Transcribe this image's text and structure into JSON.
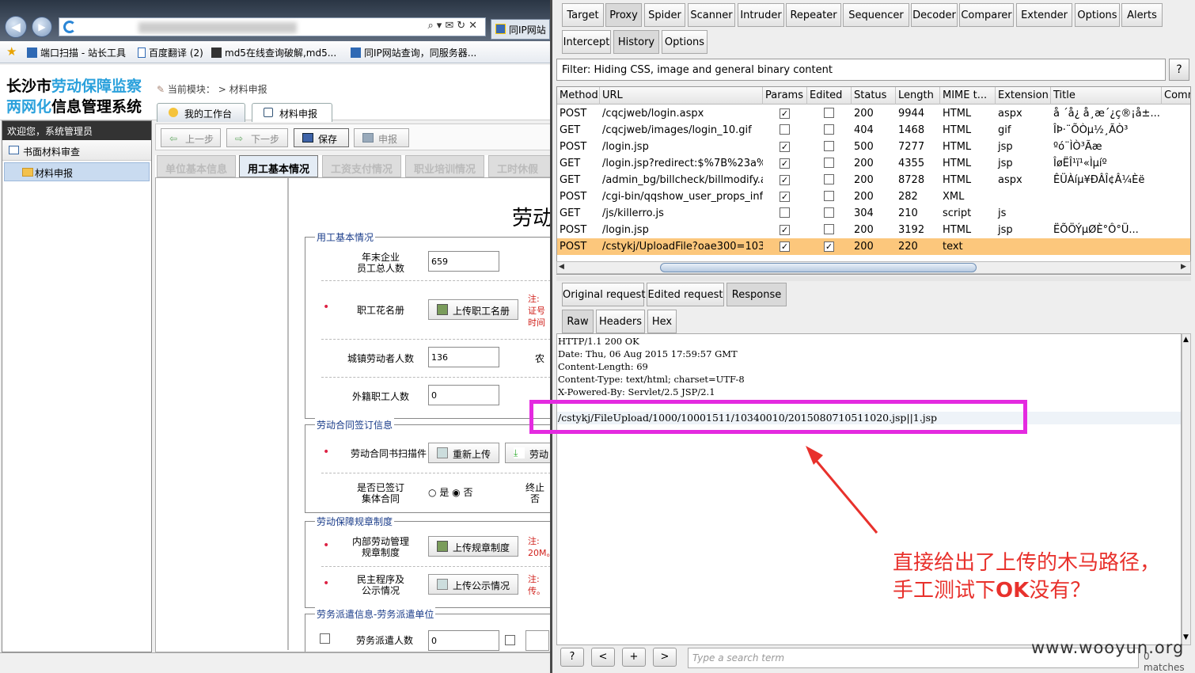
{
  "ie": {
    "tab_title": "同IP网站",
    "favorites": [
      {
        "label": "端口扫描 - 站长工具"
      },
      {
        "label": "百度翻译 (2)"
      },
      {
        "label": "md5在线查询破解,md5..."
      },
      {
        "label": "同IP网站查询，同服务器..."
      }
    ]
  },
  "app": {
    "logo_line1_a": "长沙市",
    "logo_line1_b": "劳动保障监察",
    "logo_line2_a": "两网化",
    "logo_line2_b": "信息管理系统",
    "breadcrumb_label": "当前模块：",
    "breadcrumb_value": "> 材料申报",
    "top_tabs": [
      "我的工作台",
      "材料申报"
    ],
    "sidebar": {
      "welcome": "欢迎您，系统管理员",
      "group": "书面材料审查",
      "item": "材料申报"
    },
    "toolbar": {
      "prev": "上一步",
      "next": "下一步",
      "save": "保存",
      "submit": "申报"
    },
    "form_tabs": [
      "单位基本信息",
      "用工基本情况",
      "工资支付情况",
      "职业培训情况",
      "工时休假"
    ],
    "doc_title": "劳动",
    "sections": [
      {
        "legend": "用工基本情况"
      },
      {
        "legend": "劳动合同签订信息"
      },
      {
        "legend": "劳动保障规章制度"
      },
      {
        "legend": "劳务派遣信息-劳务派遣单位"
      }
    ],
    "fields": {
      "total_staff_label_1": "年末企业",
      "total_staff_label_2": "员工总人数",
      "total_staff_value": "659",
      "roster_label": "职工花名册",
      "roster_btn": "上传职工名册",
      "roster_note_1": "注:",
      "roster_note_2": "证号",
      "roster_note_3": "时间",
      "urban_label": "城镇劳动者人数",
      "urban_value": "136",
      "urban_side": "农",
      "foreign_label": "外籍职工人数",
      "foreign_value": "0",
      "contract_scan_label": "劳动合同书扫描件",
      "contract_reupload": "重新上传",
      "contract_side_btn": "劳动",
      "collective_label_1": "是否已签订",
      "collective_label_2": "集体合同",
      "yes": "是",
      "no": "否",
      "collective_side_1": "终止",
      "collective_side_2": "否",
      "rules_label_1": "内部劳动管理",
      "rules_label_2": "规章制度",
      "rules_btn": "上传规章制度",
      "rules_note_1": "注:",
      "rules_note_2": "20M。",
      "democracy_label_1": "民主程序及",
      "democracy_label_2": "公示情况",
      "democracy_btn": "上传公示情况",
      "democracy_note_1": "注:",
      "democracy_note_2": "传。",
      "dispatch_label": "劳务派遣人数",
      "dispatch_value": "0"
    }
  },
  "burp": {
    "main_tabs": [
      "Target",
      "Proxy",
      "Spider",
      "Scanner",
      "Intruder",
      "Repeater",
      "Sequencer",
      "Decoder",
      "Comparer",
      "Extender",
      "Options",
      "Alerts"
    ],
    "sub_tabs": [
      "Intercept",
      "History",
      "Options"
    ],
    "filter": "Filter: Hiding CSS, image and general binary content",
    "filter_help": "?",
    "columns": [
      "Method",
      "URL",
      "Params",
      "Edited",
      "Status",
      "Length",
      "MIME t...",
      "Extension",
      "Title",
      "Comm"
    ],
    "rows": [
      {
        "method": "POST",
        "url": "/cqcjweb/login.aspx",
        "params": true,
        "edited": false,
        "status": "200",
        "length": "9944",
        "mime": "HTML",
        "ext": "aspx",
        "title": "å  ´å¿ å¸æ´¿ç®¡å±..."
      },
      {
        "method": "GET",
        "url": "/cqcjweb/images/login_10.gif",
        "params": false,
        "edited": false,
        "status": "404",
        "length": "1468",
        "mime": "HTML",
        "ext": "gif",
        "title": "ÎÞ·¨ÕÒµ½¸ÃÒ³"
      },
      {
        "method": "POST",
        "url": "/login.jsp",
        "params": true,
        "edited": false,
        "status": "500",
        "length": "7277",
        "mime": "HTML",
        "ext": "jsp",
        "title": "ºó¨ÌÒ³Ãæ"
      },
      {
        "method": "GET",
        "url": "/login.jsp?redirect:$%7B%23a%...",
        "params": true,
        "edited": false,
        "status": "200",
        "length": "4355",
        "mime": "HTML",
        "ext": "jsp",
        "title": "ÎøËÎ¹ï¹«Ìµíº"
      },
      {
        "method": "GET",
        "url": "/admin_bg/billcheck/billmodify.a...",
        "params": true,
        "edited": false,
        "status": "200",
        "length": "8728",
        "mime": "HTML",
        "ext": "aspx",
        "title": "ÊÜÀíµ¥ÐÂÎ¢Â¼Èë"
      },
      {
        "method": "POST",
        "url": "/cgi-bin/qqshow_user_props_info",
        "params": true,
        "edited": false,
        "status": "200",
        "length": "282",
        "mime": "XML",
        "ext": "",
        "title": ""
      },
      {
        "method": "GET",
        "url": "/js/killerro.js",
        "params": false,
        "edited": false,
        "status": "304",
        "length": "210",
        "mime": "script",
        "ext": "js",
        "title": ""
      },
      {
        "method": "POST",
        "url": "/login.jsp",
        "params": true,
        "edited": false,
        "status": "200",
        "length": "3192",
        "mime": "HTML",
        "ext": "jsp",
        "title": "ËÕÖÝµØÈ°Ô°Ü..."
      },
      {
        "method": "POST",
        "url": "/cstykj/UploadFile?oae300=103...",
        "params": true,
        "edited": true,
        "status": "200",
        "length": "220",
        "mime": "text",
        "ext": "",
        "title": ""
      }
    ],
    "msg_tabs": [
      "Original request",
      "Edited request",
      "Response"
    ],
    "view_tabs": [
      "Raw",
      "Headers",
      "Hex"
    ],
    "response_lines": [
      "HTTP/1.1 200 OK",
      "Date: Thu, 06 Aug 2015 17:59:57 GMT",
      "Content-Length: 69",
      "Content-Type: text/html; charset=UTF-8",
      "X-Powered-By: Servlet/2.5 JSP/2.1",
      "",
      "/cstykj/FileUpload/1000/10001511/10340010/2015080710511020.jsp||1.jsp"
    ],
    "search_placeholder": "Type a search term",
    "search_buttons": [
      "?",
      "<",
      "+",
      ">"
    ],
    "matches": "0 matches"
  },
  "annotation": {
    "line1": "直接给出了上传的木马路径，",
    "line2_a": "手工测试下",
    "line2_ok": "OK",
    "line2_b": "没有？",
    "color": "#e8312c"
  },
  "watermark": "www.wooyun.org"
}
